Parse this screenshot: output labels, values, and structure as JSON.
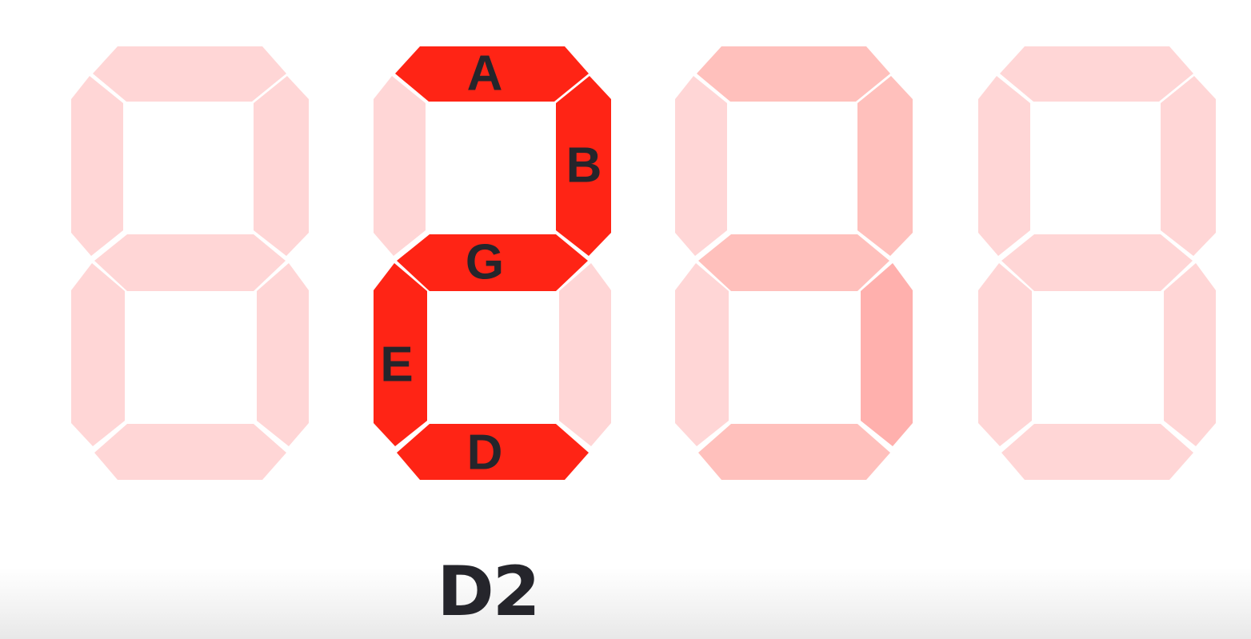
{
  "digits": [
    {
      "id": "d1",
      "segments": {
        "A": "dim",
        "B": "dim",
        "C": "dim",
        "D": "dim",
        "E": "dim",
        "F": "dim",
        "G": "dim"
      },
      "labels": {}
    },
    {
      "id": "d2",
      "segments": {
        "A": "on",
        "B": "on",
        "C": "dim",
        "D": "on",
        "E": "on",
        "F": "dim",
        "G": "on"
      },
      "labels": {
        "A": "A",
        "B": "B",
        "G": "G",
        "E": "E",
        "D": "D"
      }
    },
    {
      "id": "d3",
      "segments": {
        "A": "mid",
        "B": "mid",
        "C": "mid2",
        "D": "mid",
        "E": "dim",
        "F": "dim",
        "G": "mid"
      },
      "labels": {}
    },
    {
      "id": "d4",
      "segments": {
        "A": "dim",
        "B": "dim",
        "C": "dim",
        "D": "dim",
        "E": "dim",
        "F": "dim",
        "G": "dim"
      },
      "labels": {}
    }
  ],
  "colors": {
    "on": "#ff2415",
    "dim": "#ffd6d6",
    "mid": "#ffc0bc",
    "mid2": "#ffb0ad",
    "label_text": "#25252b"
  },
  "caption": "D2"
}
